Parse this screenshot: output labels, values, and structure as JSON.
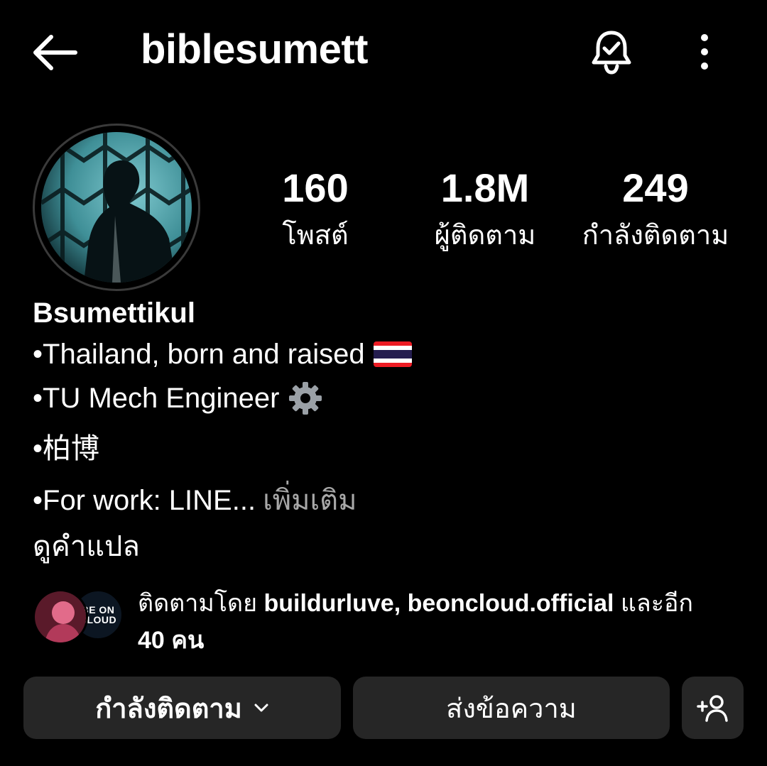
{
  "header": {
    "username": "biblesumett",
    "back_icon": "arrow-left-icon",
    "bell_icon": "bell-check-icon",
    "more_icon": "more-vertical-icon"
  },
  "stats": {
    "posts": {
      "value": "160",
      "label": "โพสต์"
    },
    "followers": {
      "value": "1.8M",
      "label": "ผู้ติดตาม"
    },
    "following": {
      "value": "249",
      "label": "กำลังติดตาม"
    }
  },
  "bio": {
    "full_name": "Bsumettikul",
    "line1": "•Thailand, born and raised",
    "line1_emoji": "thailand-flag-icon",
    "line2": "•TU Mech Engineer",
    "line2_emoji": "gear-icon",
    "line3": "•柏博",
    "line4": "•For work: LINE...",
    "more": "เพิ่มเติม",
    "translate": "ดูคำแปล"
  },
  "mutual": {
    "prefix": "ติดตามโดย",
    "names": "buildurluve, beoncloud.official",
    "suffix": "และอีก",
    "count": "40 คน",
    "avatar2_logo_line1": "BE ON",
    "avatar2_logo_line2": "CLOUD"
  },
  "buttons": {
    "following": "กำลังติดตาม",
    "message": "ส่งข้อความ",
    "add_icon": "add-person-icon"
  },
  "colors": {
    "background": "#000000",
    "button_bg": "#262626",
    "muted_text": "#a8a8a8"
  }
}
